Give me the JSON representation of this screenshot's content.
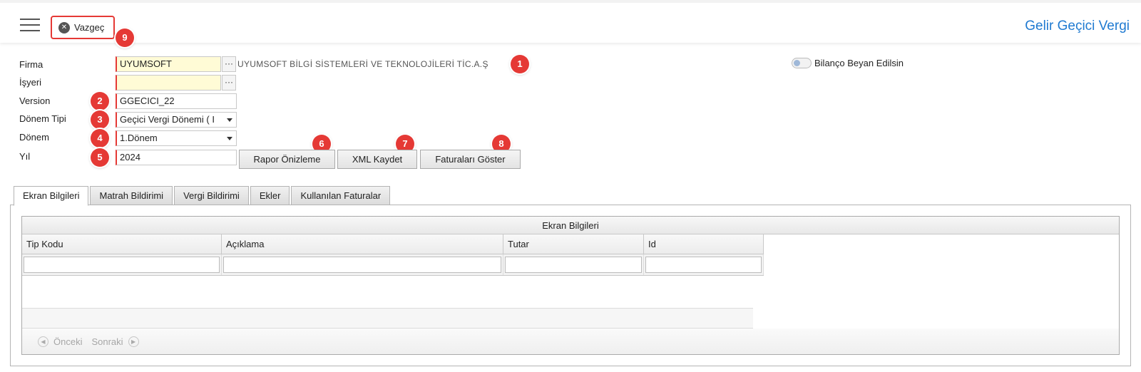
{
  "header": {
    "cancel_label": "Vazgeç",
    "title": "Gelir Geçici Vergi"
  },
  "badges": [
    "1",
    "2",
    "3",
    "4",
    "5",
    "6",
    "7",
    "8",
    "9"
  ],
  "form": {
    "firma_label": "Firma",
    "firma_value": "UYUMSOFT",
    "firma_desc": "UYUMSOFT BİLGİ SİSTEMLERİ VE TEKNOLOJİLERİ TİC.A.Ş",
    "isyeri_label": "İşyeri",
    "isyeri_value": "",
    "version_label": "Version",
    "version_value": "GGECICI_22",
    "donem_tipi_label": "Dönem Tipi",
    "donem_tipi_value": "Geçici Vergi Dönemi ( I",
    "donem_label": "Dönem",
    "donem_value": "1.Dönem",
    "yil_label": "Yıl",
    "yil_value": "2024",
    "bilanco_label": "Bilanço Beyan Edilsin",
    "lookup_dots": "···"
  },
  "buttons": {
    "rapor": "Rapor Önizleme",
    "xml": "XML Kaydet",
    "faturalar": "Faturaları Göster"
  },
  "tabs": [
    {
      "label": "Ekran Bilgileri",
      "active": true
    },
    {
      "label": "Matrah Bildirimi",
      "active": false
    },
    {
      "label": "Vergi Bildirimi",
      "active": false
    },
    {
      "label": "Ekler",
      "active": false
    },
    {
      "label": "Kullanılan Faturalar",
      "active": false
    }
  ],
  "grid": {
    "caption": "Ekran Bilgileri",
    "columns": [
      "Tip Kodu",
      "Açıklama",
      "Tutar",
      "Id"
    ],
    "rows": [],
    "prev": "Önceki",
    "next": "Sonraki"
  },
  "colors": {
    "accent": "#1f7ad1",
    "badge": "#e53935",
    "required_field": "#fffbd6"
  }
}
